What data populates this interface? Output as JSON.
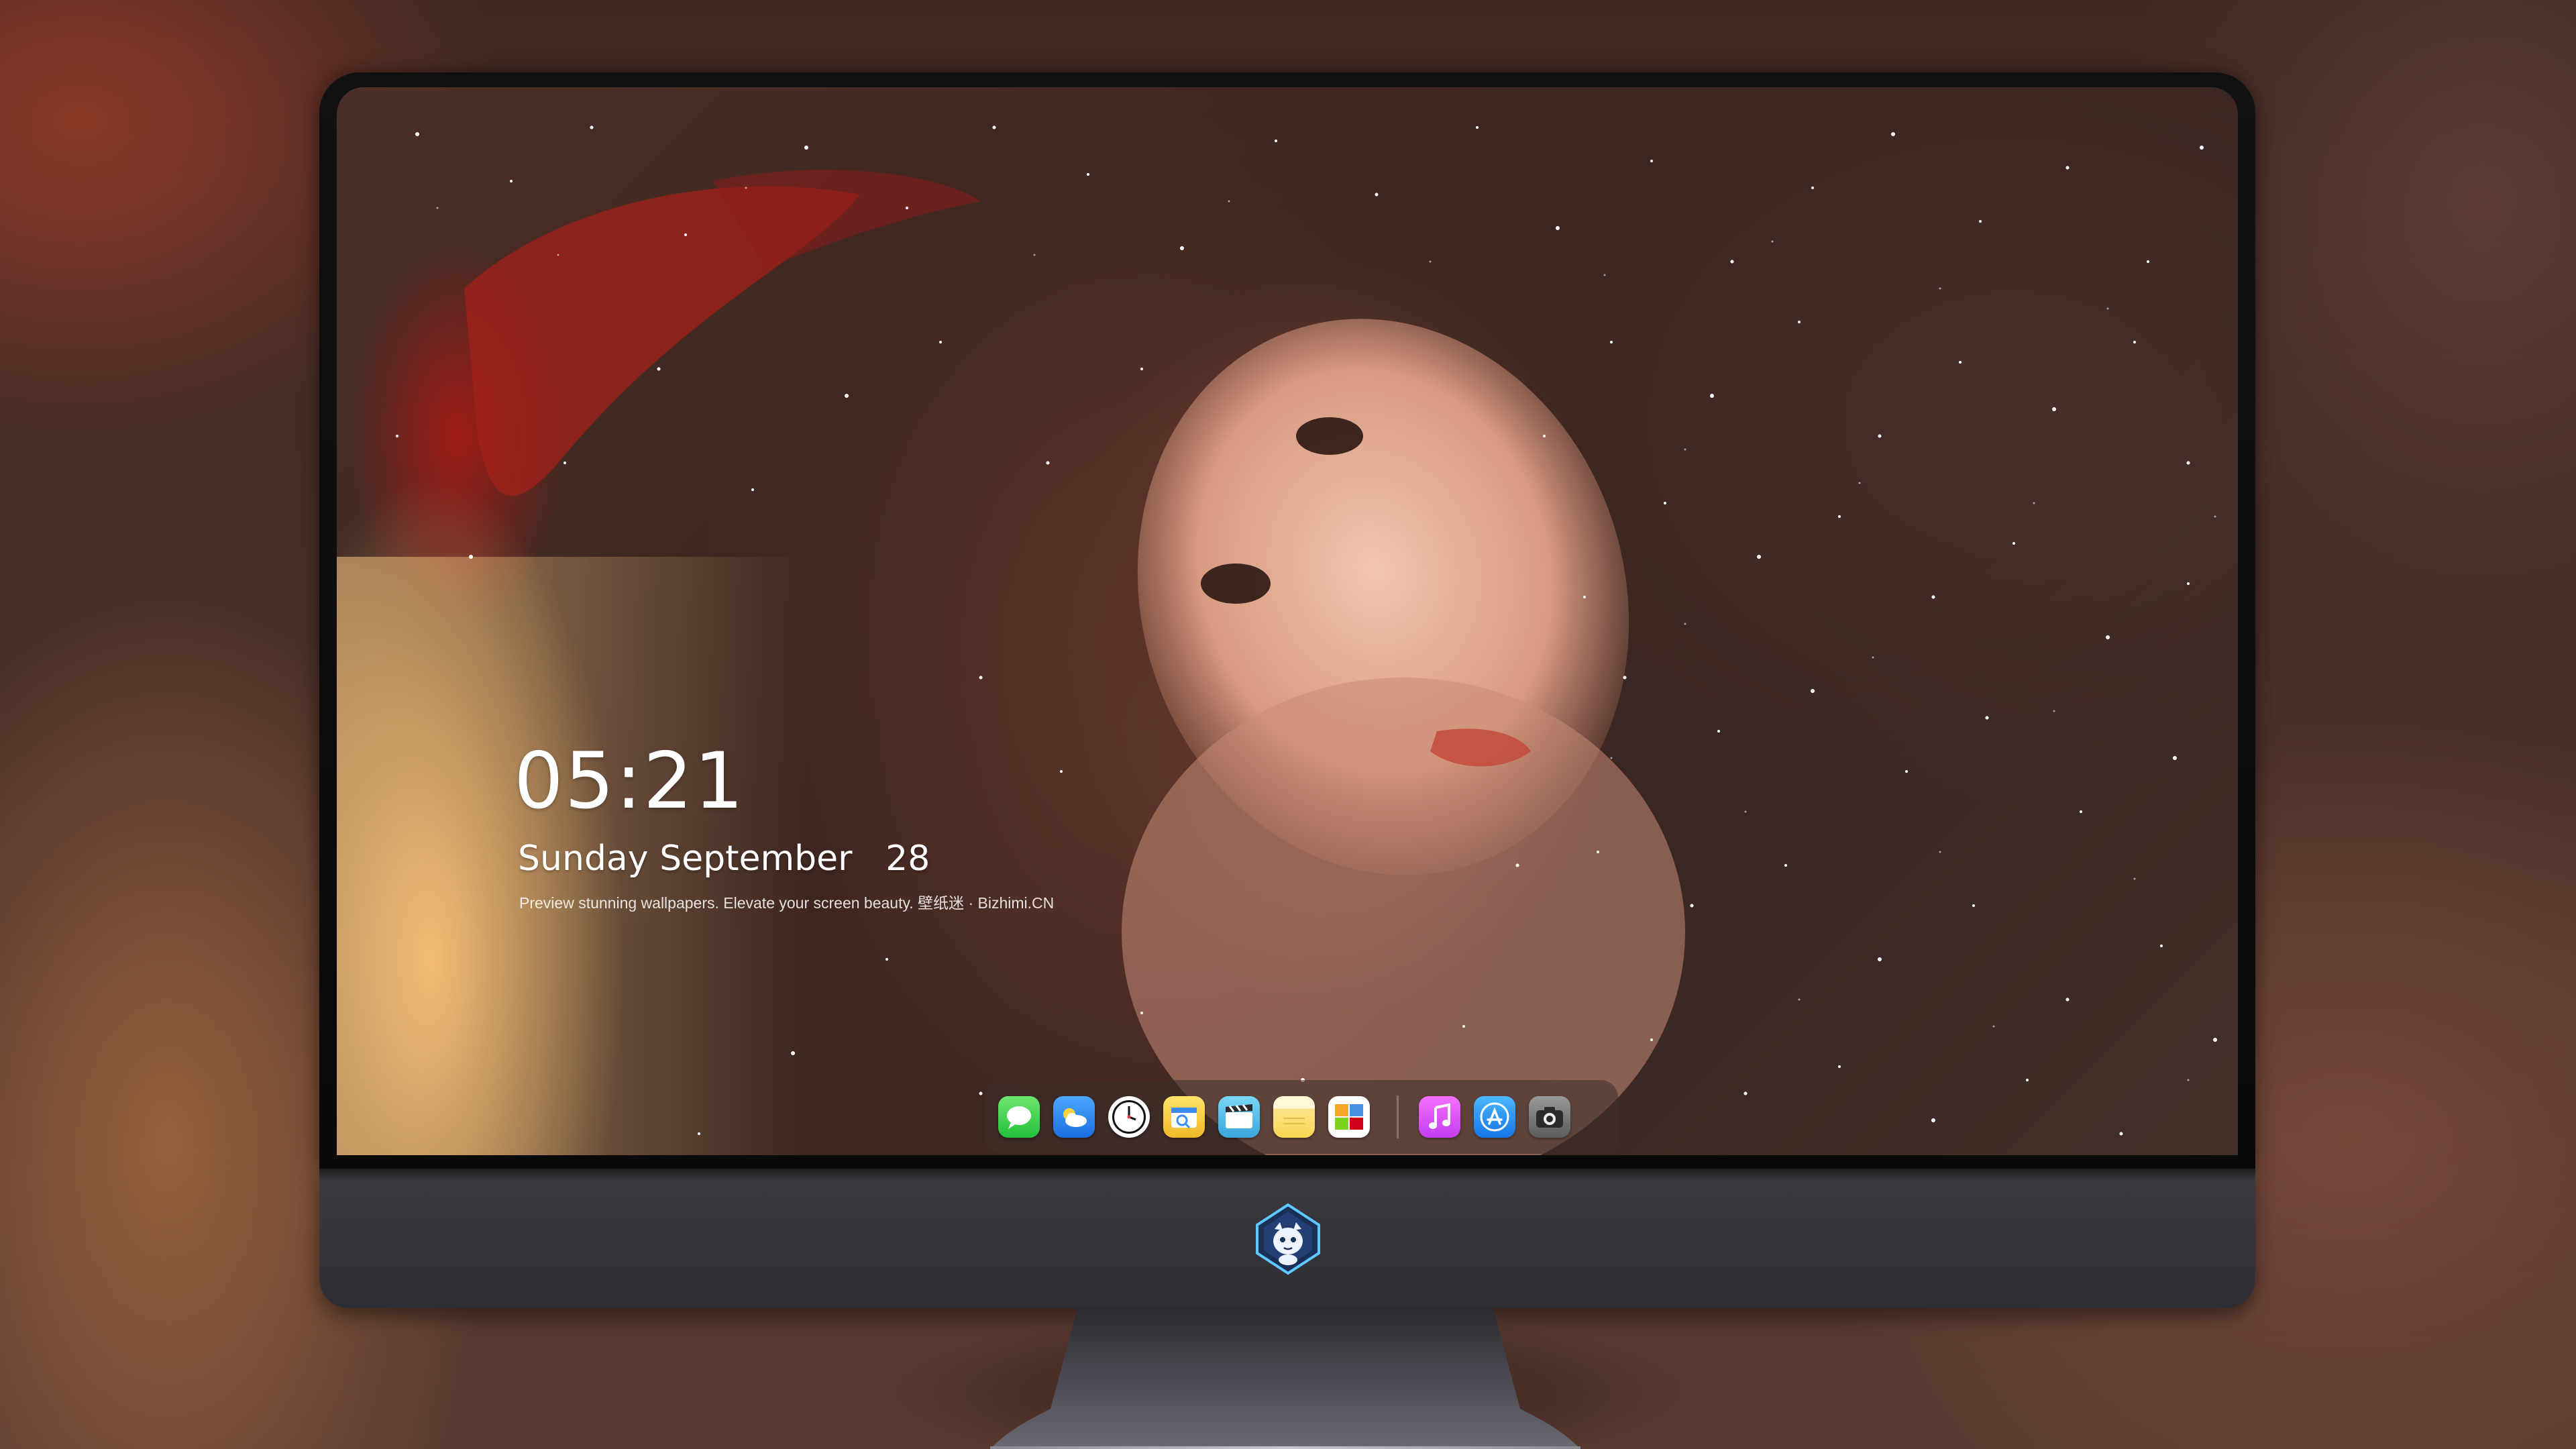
{
  "lock_screen": {
    "time": "05:21",
    "date": "Sunday September   28",
    "tagline": "Preview stunning wallpapers. Elevate your screen beauty. 壁纸迷 · Bizhimi.CN"
  },
  "dock": {
    "apps": [
      {
        "name": "messages-icon"
      },
      {
        "name": "weather-icon"
      },
      {
        "name": "clock-icon"
      },
      {
        "name": "finder-icon"
      },
      {
        "name": "clips-icon"
      },
      {
        "name": "notes-icon"
      },
      {
        "name": "photos-icon"
      },
      {
        "name": "music-icon"
      },
      {
        "name": "app-store-icon"
      },
      {
        "name": "camera-icon"
      }
    ]
  },
  "device": {
    "logo": "dragon-mascot-logo"
  },
  "colors": {
    "bezel": "#0d0d0d",
    "chin": "#36353b",
    "stand": "#4a4a52",
    "clock_text": "#ffffff",
    "dock_bg": "#3c2d2a"
  }
}
